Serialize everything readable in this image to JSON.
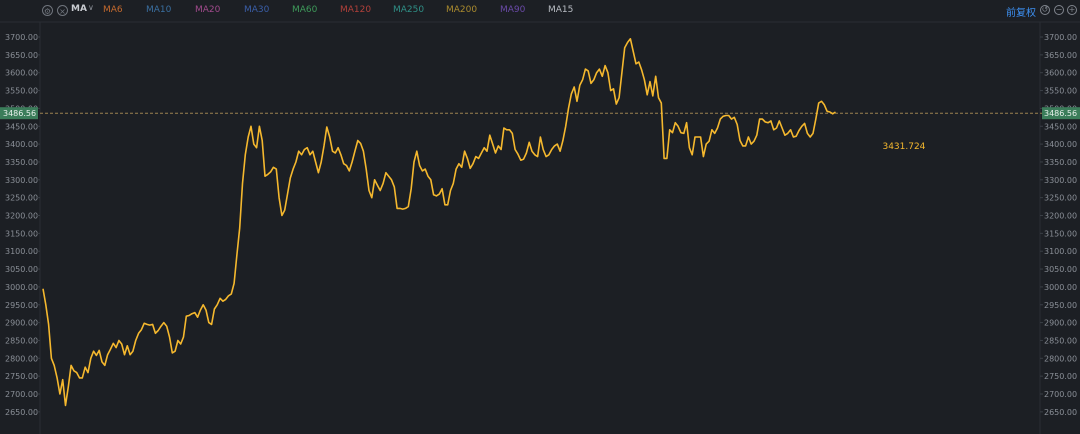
{
  "toolbar": {
    "settings_icon": "gear-icon",
    "close_icon": "close-icon",
    "indicator_label": "MA",
    "caret": "∨",
    "ma_items": [
      {
        "label": "MA6",
        "color": "#c46a2e"
      },
      {
        "label": "MA10",
        "color": "#3a6fa0"
      },
      {
        "label": "MA20",
        "color": "#a04a8c"
      },
      {
        "label": "MA30",
        "color": "#3a5ea8"
      },
      {
        "label": "MA60",
        "color": "#3e9a5a"
      },
      {
        "label": "MA120",
        "color": "#b0403a"
      },
      {
        "label": "MA250",
        "color": "#2f8f86"
      },
      {
        "label": "MA200",
        "color": "#a98a2e"
      },
      {
        "label": "MA90",
        "color": "#6a4aa8"
      },
      {
        "label": "MA15",
        "color": "#b8bcc3"
      }
    ],
    "adjust_label": "前复权",
    "undo_icon": "undo-icon",
    "zoom_out_icon": "zoom-out-icon",
    "zoom_in_icon": "zoom-in-icon"
  },
  "colors": {
    "background": "#1c1f24",
    "line": "#f5b82e",
    "grid": "#2a2e34",
    "axis_text": "#8a8f97",
    "ref_badge": "#3b7d5a",
    "accent_link": "#3d8ff0"
  },
  "chart_data": {
    "type": "line",
    "title": "",
    "xlabel": "",
    "ylabel": "",
    "ylim": [
      2632,
      3718
    ],
    "grid": false,
    "y_ticks": [
      "3700.00",
      "3650.00",
      "3600.00",
      "3550.00",
      "3500.00",
      "3450.00",
      "3400.00",
      "3350.00",
      "3300.00",
      "3250.00",
      "3200.00",
      "3150.00",
      "3100.00",
      "3050.00",
      "3000.00",
      "2950.00",
      "2900.00",
      "2850.00",
      "2800.00",
      "2750.00",
      "2700.00",
      "2650.00"
    ],
    "reference_line": {
      "value": 3486.56,
      "label": "3486.56"
    },
    "annotation": {
      "text": "3431.724",
      "x": 298,
      "y": 3408
    },
    "x": [
      0,
      1,
      2,
      3,
      4,
      5,
      6,
      7,
      8,
      9,
      10,
      11,
      12,
      13,
      14,
      15,
      16,
      17,
      18,
      19,
      20,
      21,
      22,
      23,
      24,
      25,
      26,
      27,
      28,
      29,
      30,
      31,
      32,
      33,
      34,
      35,
      36,
      37,
      38,
      39,
      40,
      41,
      42,
      43,
      44,
      45,
      46,
      47,
      48,
      49,
      50,
      51,
      52,
      53,
      54,
      55,
      56,
      57,
      58,
      59,
      60,
      61,
      62,
      63,
      64,
      65,
      66,
      67,
      68,
      69,
      70,
      71,
      72,
      73,
      74,
      75,
      76,
      77,
      78,
      79,
      80,
      81,
      82,
      83,
      84,
      85,
      86,
      87,
      88,
      89,
      90,
      91,
      92,
      93,
      94,
      95,
      96,
      97,
      98,
      99,
      100,
      101,
      102,
      103,
      104,
      105,
      106,
      107,
      108,
      109,
      110,
      111,
      112,
      113,
      114,
      115,
      116,
      117,
      118,
      119,
      120,
      121,
      122,
      123,
      124,
      125,
      126,
      127,
      128,
      129,
      130,
      131,
      132,
      133,
      134,
      135,
      136,
      137,
      138,
      139,
      140,
      141,
      142,
      143,
      144,
      145,
      146,
      147,
      148,
      149,
      150,
      151,
      152,
      153,
      154,
      155,
      156,
      157,
      158,
      159,
      160,
      161,
      162,
      163,
      164,
      165,
      166,
      167,
      168,
      169,
      170,
      171,
      172,
      173,
      174,
      175,
      176,
      177,
      178,
      179,
      180,
      181,
      182,
      183,
      184,
      185,
      186,
      187,
      188,
      189,
      190,
      191,
      192,
      193,
      194,
      195,
      196,
      197,
      198,
      199,
      200,
      201,
      202,
      203,
      204,
      205,
      206,
      207,
      208,
      209,
      210,
      211,
      212,
      213,
      214,
      215,
      216,
      217,
      218,
      219,
      220,
      221,
      222,
      223,
      224,
      225,
      226,
      227,
      228,
      229,
      230,
      231,
      232,
      233,
      234,
      235,
      236,
      237,
      238,
      239,
      240,
      241,
      242,
      243,
      244,
      245,
      246,
      247,
      248,
      249,
      250,
      251,
      252,
      253,
      254,
      255,
      256,
      257,
      258,
      259,
      260,
      261,
      262,
      263,
      264,
      265,
      266,
      267,
      268,
      269,
      270,
      271,
      272,
      273,
      274,
      275,
      276,
      277,
      278,
      279,
      280,
      281,
      282,
      283,
      284,
      285,
      286,
      287,
      288,
      289,
      290,
      291,
      292,
      293,
      294,
      295,
      296,
      297,
      298,
      299,
      300,
      301,
      302,
      303,
      304,
      305,
      306,
      307,
      308,
      309,
      310,
      311,
      312,
      313,
      314,
      315,
      316,
      317,
      318,
      319,
      320,
      321,
      322,
      323,
      324,
      325,
      326,
      327,
      328,
      329,
      330,
      331,
      332,
      333,
      334,
      335,
      336,
      337,
      338,
      339,
      340,
      341,
      342,
      343,
      344,
      345,
      346,
      347,
      348
    ],
    "series": [
      {
        "values": [
          2995,
          2950,
          2895,
          2800,
          2780,
          2745,
          2700,
          2740,
          2668,
          2720,
          2780,
          2765,
          2760,
          2745,
          2745,
          2775,
          2760,
          2800,
          2820,
          2808,
          2822,
          2790,
          2780,
          2810,
          2825,
          2842,
          2830,
          2850,
          2840,
          2810,
          2835,
          2810,
          2820,
          2850,
          2870,
          2880,
          2898,
          2895,
          2893,
          2895,
          2870,
          2878,
          2890,
          2900,
          2890,
          2860,
          2815,
          2820,
          2850,
          2840,
          2860,
          2918,
          2920,
          2925,
          2928,
          2915,
          2935,
          2950,
          2935,
          2900,
          2895,
          2938,
          2950,
          2968,
          2960,
          2965,
          2975,
          2980,
          3010,
          3090,
          3165,
          3290,
          3370,
          3420,
          3450,
          3400,
          3390,
          3450,
          3410,
          3310,
          3315,
          3322,
          3335,
          3330,
          3250,
          3200,
          3215,
          3260,
          3305,
          3330,
          3350,
          3380,
          3370,
          3385,
          3390,
          3370,
          3380,
          3350,
          3320,
          3350,
          3395,
          3448,
          3420,
          3380,
          3375,
          3390,
          3370,
          3345,
          3340,
          3325,
          3350,
          3380,
          3410,
          3402,
          3380,
          3330,
          3270,
          3250,
          3300,
          3285,
          3270,
          3290,
          3320,
          3310,
          3300,
          3280,
          3220,
          3220,
          3218,
          3220,
          3225,
          3275,
          3350,
          3380,
          3340,
          3325,
          3330,
          3310,
          3300,
          3258,
          3255,
          3260,
          3275,
          3230,
          3230,
          3270,
          3290,
          3330,
          3345,
          3335,
          3380,
          3360,
          3332,
          3345,
          3365,
          3360,
          3375,
          3390,
          3380,
          3425,
          3400,
          3375,
          3395,
          3385,
          3445,
          3440,
          3440,
          3430,
          3385,
          3372,
          3355,
          3358,
          3375,
          3405,
          3380,
          3370,
          3365,
          3420,
          3385,
          3365,
          3370,
          3385,
          3395,
          3400,
          3380,
          3410,
          3450,
          3500,
          3540,
          3560,
          3520,
          3565,
          3580,
          3610,
          3605,
          3570,
          3580,
          3600,
          3610,
          3590,
          3620,
          3600,
          3550,
          3555,
          3512,
          3530,
          3600,
          3670,
          3685,
          3695,
          3660,
          3625,
          3630,
          3608,
          3580,
          3538,
          3575,
          3535,
          3590,
          3530,
          3515,
          3360,
          3360,
          3440,
          3432,
          3460,
          3450,
          3432,
          3430,
          3460,
          3390,
          3370,
          3420,
          3420,
          3420,
          3365,
          3400,
          3408,
          3440,
          3430,
          3445,
          3470,
          3478,
          3480,
          3480,
          3470,
          3475,
          3455,
          3410,
          3395,
          3395,
          3420,
          3400,
          3408,
          3425,
          3470,
          3470,
          3462,
          3460,
          3465,
          3440,
          3445,
          3465,
          3445,
          3425,
          3430,
          3440,
          3420,
          3422,
          3438,
          3450,
          3458,
          3430,
          3420,
          3430,
          3470,
          3515,
          3520,
          3510,
          3492,
          3490,
          3485,
          3490
        ]
      }
    ]
  }
}
